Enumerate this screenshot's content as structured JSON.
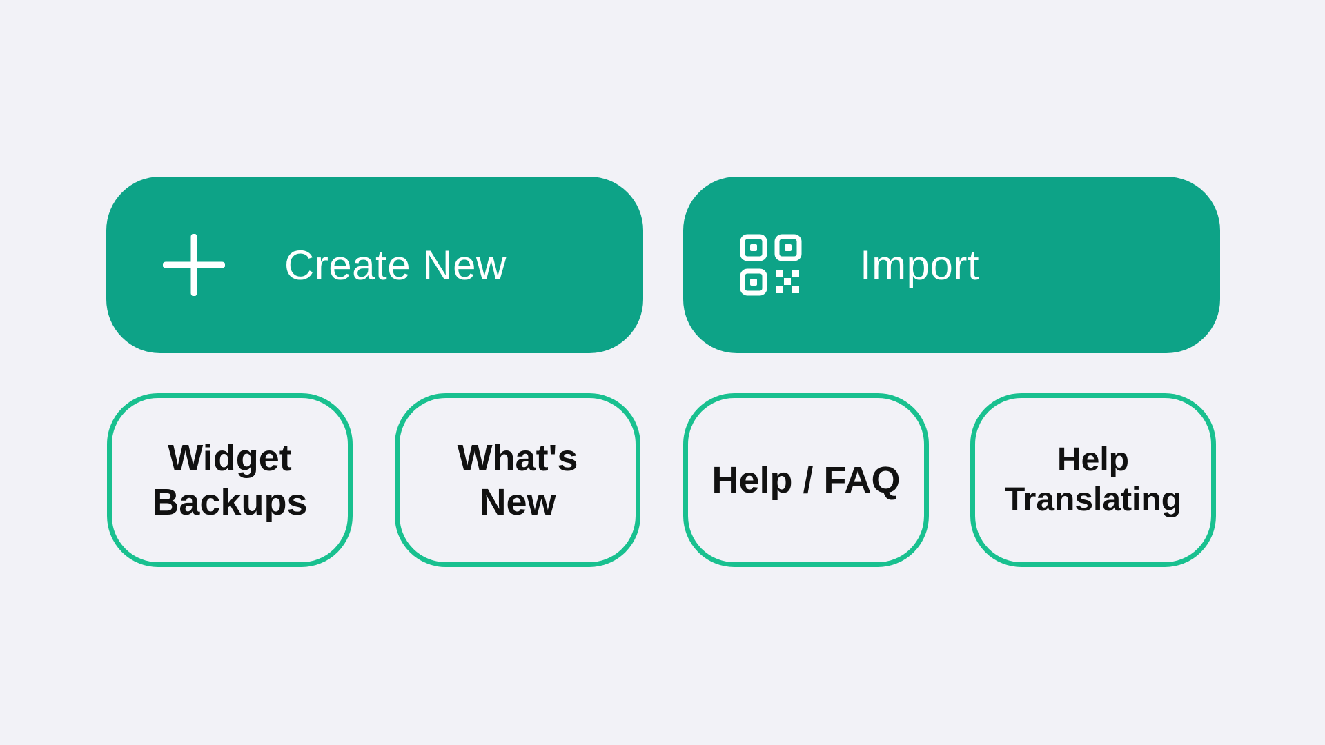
{
  "colors": {
    "background": "#f2f2f7",
    "primary": "#0da387",
    "outline": "#19c08f",
    "text_dark": "#111111",
    "text_light": "#ffffff"
  },
  "primary_actions": [
    {
      "label": "Create New",
      "icon": "plus-icon"
    },
    {
      "label": "Import",
      "icon": "qr-code-icon"
    }
  ],
  "secondary_actions": [
    {
      "lines": [
        "Widget",
        "Backups"
      ]
    },
    {
      "lines": [
        "What's",
        "New"
      ]
    },
    {
      "lines": [
        "Help / FAQ"
      ]
    },
    {
      "lines": [
        "Help",
        "Translating"
      ]
    }
  ]
}
